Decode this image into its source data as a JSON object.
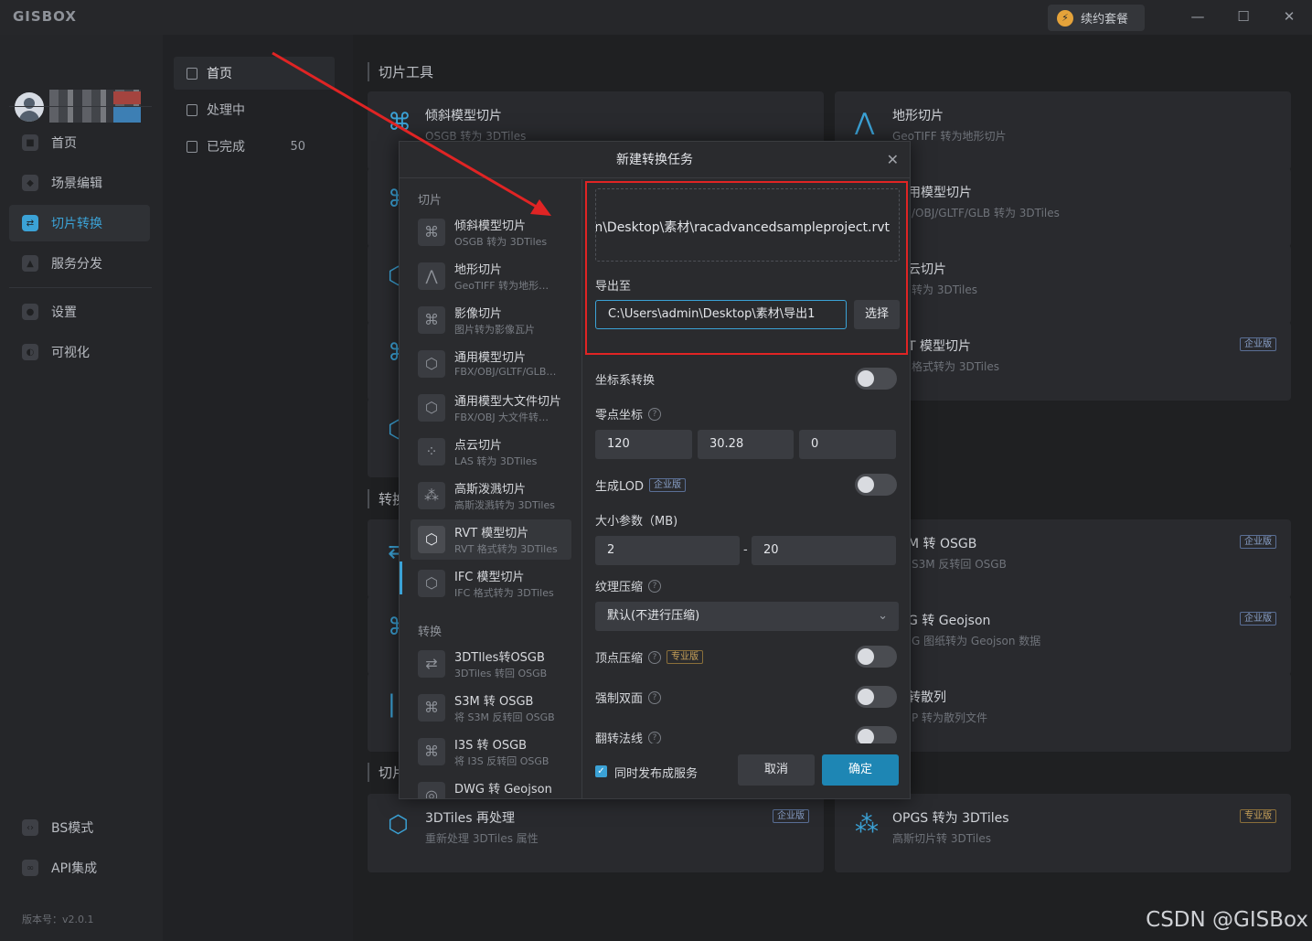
{
  "app": {
    "logo": "GISBOX",
    "renew_label": "续约套餐"
  },
  "window": {
    "minimize": "—",
    "maximize": "☐",
    "close": "✕"
  },
  "leftnav": {
    "items": [
      {
        "label": "首页",
        "icon": "home-icon"
      },
      {
        "label": "场景编辑",
        "icon": "cube-icon"
      },
      {
        "label": "切片转换",
        "icon": "convert-icon",
        "active": true
      },
      {
        "label": "服务分发",
        "icon": "upload-icon"
      },
      {
        "label": "设置",
        "icon": "gear-icon"
      },
      {
        "label": "可视化",
        "icon": "visual-icon"
      }
    ],
    "bottom": [
      {
        "label": "BS模式"
      },
      {
        "label": "API集成"
      }
    ],
    "version": "版本号：v2.0.1"
  },
  "subnav": {
    "items": [
      {
        "label": "首页",
        "active": true
      },
      {
        "label": "处理中"
      },
      {
        "label": "已完成",
        "count": "50"
      }
    ]
  },
  "main": {
    "section1": "切片工具",
    "section2": "转换",
    "section3": "切片",
    "cards": [
      {
        "title": "倾斜模型切片",
        "desc": "OSGB 转为 3DTiles"
      },
      {
        "title": "地形切片",
        "desc": "GeoTIFF 转为地形切片"
      },
      {
        "title": "用模型切片",
        "desc": "/OBJ/GLTF/GLB 转为 3DTiles"
      },
      {
        "title": "云切片",
        "desc": "转为 3DTiles"
      },
      {
        "title": "T 模型切片",
        "desc": "格式转为 3DTiles",
        "badge": "企业版"
      },
      {
        "title": "M 转 OSGB",
        "desc": "S3M 反转回 OSGB",
        "badge": "企业版"
      },
      {
        "title": "G 转 Geojson",
        "desc": "G 图纸转为 Geojson 数据",
        "badge": "企业版"
      },
      {
        "title": "转散列",
        "desc": "P 转为散列文件"
      },
      {
        "title": "3DTiles 再处理",
        "desc": "重新处理 3DTiles 属性",
        "badge": "企业版"
      },
      {
        "title": "OPGS 转为 3DTiles",
        "desc": "高斯切片转 3DTiles",
        "badge": "专业版"
      }
    ]
  },
  "dialog": {
    "title": "新建转换任务",
    "group_slice": "切片",
    "group_convert": "转换",
    "list": [
      {
        "title": "倾斜模型切片",
        "desc": "OSGB 转为 3DTiles"
      },
      {
        "title": "地形切片",
        "desc": "GeoTIFF 转为地形…"
      },
      {
        "title": "影像切片",
        "desc": "图片转为影像瓦片"
      },
      {
        "title": "通用模型切片",
        "desc": "FBX/OBJ/GLTF/GLB…"
      },
      {
        "title": "通用模型大文件切片",
        "desc": "FBX/OBJ 大文件转…"
      },
      {
        "title": "点云切片",
        "desc": "LAS 转为 3DTiles"
      },
      {
        "title": "高斯泼溅切片",
        "desc": "高斯泼溅转为 3DTiles"
      },
      {
        "title": "RVT 模型切片",
        "desc": "RVT 格式转为 3DTiles"
      },
      {
        "title": "IFC 模型切片",
        "desc": "IFC 格式转为 3DTiles"
      }
    ],
    "list2": [
      {
        "title": "3DTIles转OSGB",
        "desc": "3DTiles 转回 OSGB"
      },
      {
        "title": "S3M 转 OSGB",
        "desc": "将 S3M 反转回 OSGB"
      },
      {
        "title": "I3S 转 OSGB",
        "desc": "将 I3S 反转回 OSGB"
      },
      {
        "title": "DWG 转 Geojson",
        "desc": ""
      }
    ],
    "input_path": "C:\\Users\\admin\\Desktop\\素材\\racadvancedsampleproject.rvt",
    "export_label": "导出至",
    "export_value": "C:\\Users\\admin\\Desktop\\素材\\导出1",
    "choose": "选择",
    "crs_label": "坐标系转换",
    "origin_label": "零点坐标",
    "origin": [
      "120",
      "30.28",
      "0"
    ],
    "lod_label": "生成LOD",
    "lod_badge": "企业版",
    "size_label": "大小参数（MB)",
    "size_min": "2",
    "size_sep": "-",
    "size_max": "20",
    "texture_label": "纹理压缩",
    "texture_value": "默认(不进行压缩)",
    "vertex_label": "顶点压缩",
    "vertex_badge": "专业版",
    "double_label": "强制双面",
    "normal_label": "翻转法线",
    "publish_label": "同时发布成服务",
    "cancel": "取消",
    "confirm": "确定"
  },
  "watermark": "CSDN @GISBox",
  "colors": {
    "accent": "#3ba2d6",
    "highlight": "#e02424",
    "arrow": "#e02424"
  }
}
